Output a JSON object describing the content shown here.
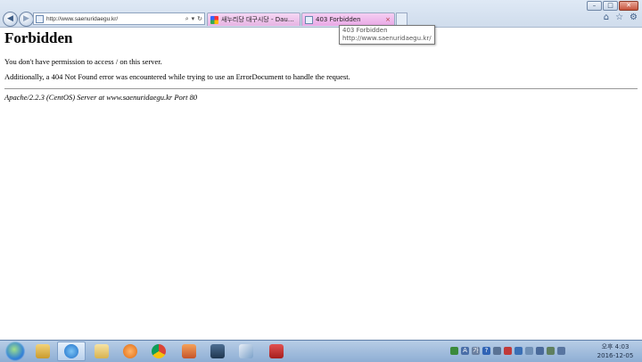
{
  "browser": {
    "address": {
      "url": "http://www.saenuridaegu.kr/",
      "tools": [
        "search-icon",
        "dropdown-icon",
        "refresh-icon"
      ]
    },
    "tabs": [
      {
        "label": "새누리당 대구시당 - Daum ...",
        "active": false,
        "favicon": "daum-icon"
      },
      {
        "label": "403 Forbidden",
        "active": true,
        "favicon": "page-icon",
        "close": "×"
      }
    ],
    "tooltip": {
      "title": "403 Forbidden",
      "url": "http://www.saenuridaegu.kr/"
    },
    "window_controls": [
      "minimize",
      "maximize",
      "close"
    ],
    "toolbar_icons": [
      "home-icon",
      "favorites-star-icon",
      "settings-gear-icon"
    ]
  },
  "page": {
    "heading": "Forbidden",
    "message": "You don't have permission to access / on this server.",
    "additional": "Additionally, a 404 Not Found error was encountered while trying to use an ErrorDocument to handle the request.",
    "signature": "Apache/2.2.3 (CentOS) Server at www.saenuridaegu.kr Port 80"
  },
  "taskbar": {
    "apps": [
      "file-explorer-icon",
      "internet-explorer-icon",
      "folder-icon",
      "media-player-icon",
      "chrome-icon",
      "app-icon",
      "window-icon",
      "notepad-icon",
      "app-red-icon"
    ],
    "tray": {
      "ime": "A",
      "lang": "가"
    },
    "clock": {
      "time": "오후 4:03",
      "date": "2016-12-05"
    }
  }
}
